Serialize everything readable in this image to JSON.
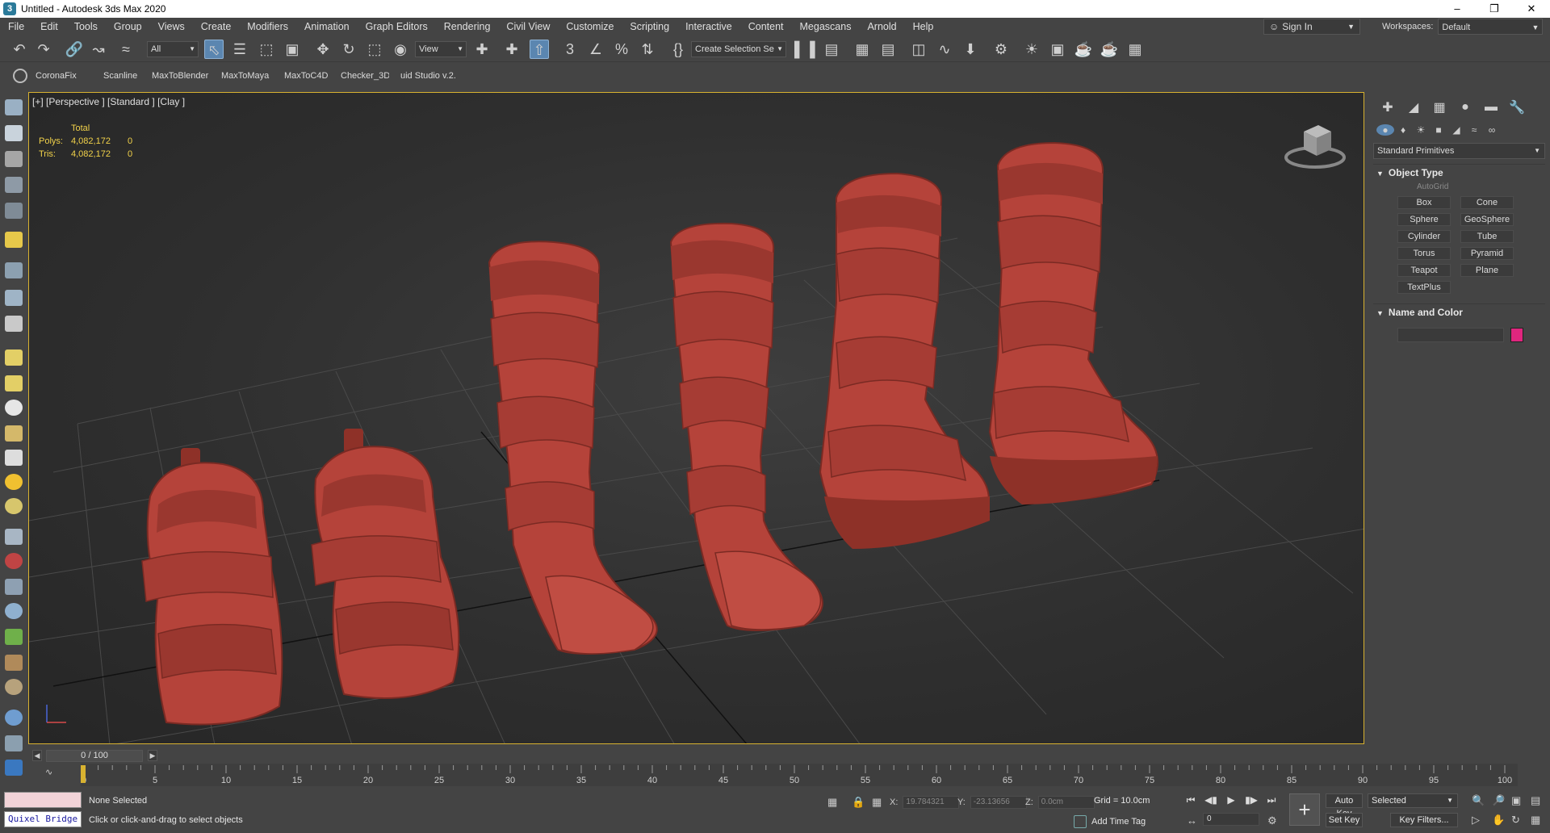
{
  "window": {
    "title": "Untitled - Autodesk 3ds Max 2020",
    "app_icon": "3",
    "controls": [
      "–",
      "❐",
      "✕"
    ]
  },
  "menu": [
    "File",
    "Edit",
    "Tools",
    "Group",
    "Views",
    "Create",
    "Modifiers",
    "Animation",
    "Graph Editors",
    "Rendering",
    "Civil View",
    "Customize",
    "Scripting",
    "Interactive",
    "Content",
    "Megascans",
    "Arnold",
    "Help"
  ],
  "account": {
    "sign_in": "Sign In",
    "workspaces_label": "Workspaces:",
    "workspace": "Default"
  },
  "toolbar": {
    "selection_filter": "All",
    "ref_coord": "View",
    "named_selection": "Create Selection Se",
    "icons": [
      "undo-icon",
      "redo-icon",
      "link-icon",
      "unlink-icon",
      "bind-spacewarp-icon",
      "select-object-icon",
      "select-by-name-icon",
      "rect-region-icon",
      "window-crossing-icon",
      "move-icon",
      "rotate-icon",
      "scale-icon",
      "placement-icon",
      "pivot-icon",
      "snap-icon",
      "angle-snap-icon",
      "percent-snap-icon",
      "spinner-snap-icon",
      "edit-named-sel-icon",
      "mirror-icon",
      "align-icon",
      "scene-explorer-icon",
      "layer-icon",
      "ribbon-icon",
      "curve-editor-icon",
      "schematic-icon",
      "material-editor-icon",
      "render-setup-icon",
      "render-frame-icon",
      "render-icon"
    ]
  },
  "plugins": [
    "CoronaFix",
    "Scanline",
    "MaxToBlender",
    "MaxToMaya",
    "MaxToC4D",
    "Checker_3D",
    "uid Studio v.2."
  ],
  "viewport": {
    "label": "[+] [Perspective ] [Standard ] [Clay ]",
    "stats_header": "Total",
    "polys_label": "Polys:",
    "polys_value": "4,082,172",
    "polys_sel": "0",
    "tris_label": "Tris:",
    "tris_value": "4,082,172",
    "tris_sel": "0"
  },
  "command_panel": {
    "category": "Standard Primitives",
    "object_type_title": "Object Type",
    "autogrid": "AutoGrid",
    "primitives": [
      "Box",
      "Cone",
      "Sphere",
      "GeoSphere",
      "Cylinder",
      "Tube",
      "Torus",
      "Pyramid",
      "Teapot",
      "Plane",
      "TextPlus"
    ],
    "name_color_title": "Name and Color",
    "object_color": "#e0267e"
  },
  "time": {
    "frame_display": "0 / 100",
    "ticks": [
      "0",
      "5",
      "10",
      "15",
      "20",
      "25",
      "30",
      "35",
      "40",
      "45",
      "50",
      "55",
      "60",
      "65",
      "70",
      "75",
      "80",
      "85",
      "90",
      "95",
      "100"
    ]
  },
  "status": {
    "quixel": "Quixel Bridge",
    "selection": "None Selected",
    "prompt": "Click or click-and-drag to select objects",
    "x_label": "X:",
    "x_value": "19.784321",
    "y_label": "Y:",
    "y_value": "-23.13656",
    "z_label": "Z:",
    "z_value": "0.0cm",
    "grid": "Grid = 10.0cm",
    "add_time_tag": "Add Time Tag",
    "current_frame": "0",
    "auto_key": "Auto Key",
    "set_key": "Set Key",
    "selection_set": "Selected",
    "key_filters": "Key Filters..."
  },
  "colors": {
    "viewport_border": "#d8b230",
    "boot_clay": "#b5433a",
    "stats_text": "#f2d24a"
  }
}
